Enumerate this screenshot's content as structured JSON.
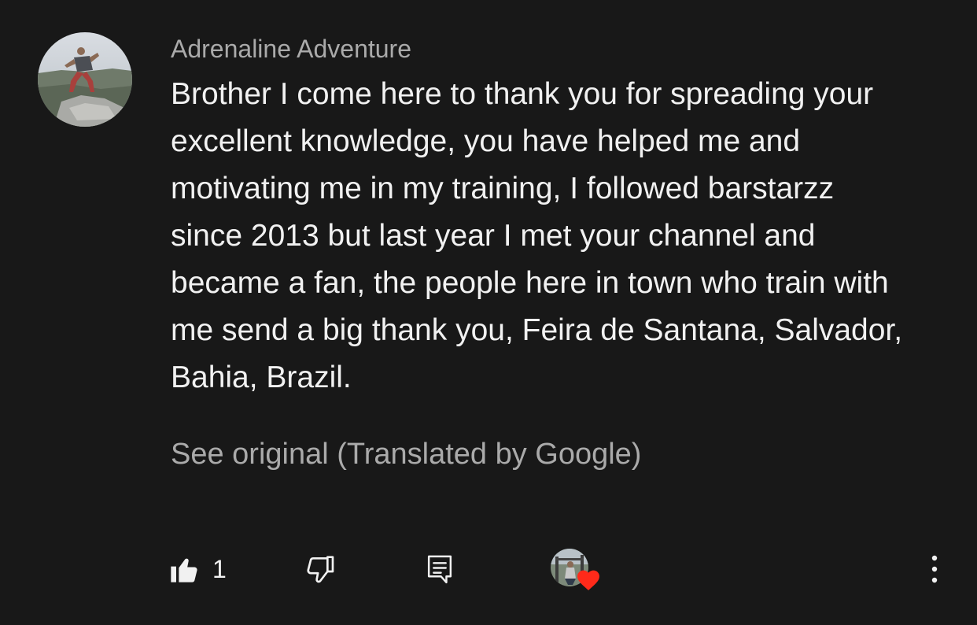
{
  "comment": {
    "author": "Adrenaline Adventure",
    "text_lines": [
      "Brother I come here to thank you for spreading your",
      "excellent knowledge, you have helped me and",
      "motivating me in my training, I followed barstarzz",
      "since 2013 but last year I met your channel and",
      "became a fan, the people here in town who train with",
      "me send a big thank you, Feira de Santana, Salvador,",
      "Bahia, Brazil."
    ],
    "see_original": "See original (Translated by Google)"
  },
  "actions": {
    "like_icon": "thumbs-up-icon",
    "like_count": "1",
    "dislike_icon": "thumbs-down-icon",
    "reply_icon": "reply-comment-icon",
    "creator_heart_icon": "heart-icon",
    "more_icon": "more-vertical-icon"
  },
  "colors": {
    "background": "#181818",
    "author": "#aaaaaa",
    "text": "#f1f1f1",
    "secondary": "#aaaaaa",
    "heart": "#ff2a1a"
  }
}
